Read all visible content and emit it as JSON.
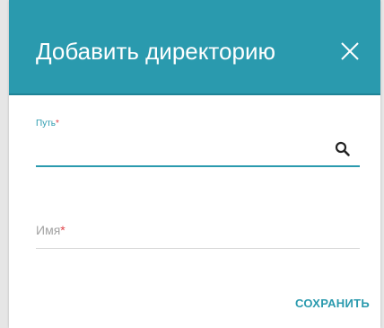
{
  "dialog": {
    "title": "Добавить директорию",
    "close_icon": "close-icon",
    "colors": {
      "header": "#2a9aae",
      "accent": "#2a9aae",
      "required": "#e0454b"
    }
  },
  "fields": {
    "path": {
      "label": "Путь",
      "required_mark": "*",
      "value": "",
      "search_icon": "search-icon"
    },
    "name": {
      "label": "Имя",
      "required_mark": "*",
      "value": ""
    }
  },
  "actions": {
    "save_label": "СОХРАНИТЬ"
  }
}
